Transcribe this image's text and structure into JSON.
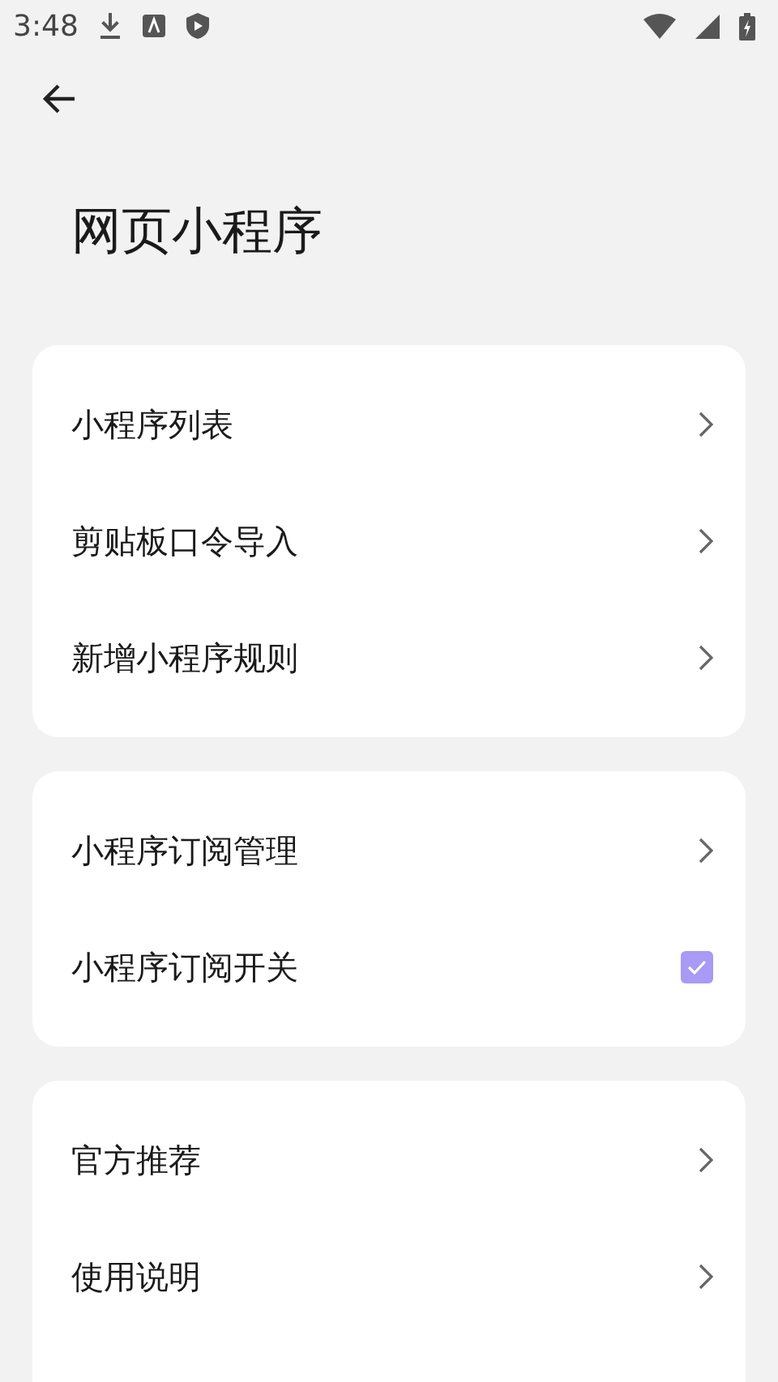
{
  "status_bar": {
    "time": "3:48"
  },
  "title": "网页小程序",
  "groups": [
    {
      "items": [
        {
          "kind": "link",
          "label": "小程序列表"
        },
        {
          "kind": "link",
          "label": "剪贴板口令导入"
        },
        {
          "kind": "link",
          "label": "新增小程序规则"
        }
      ]
    },
    {
      "items": [
        {
          "kind": "link",
          "label": "小程序订阅管理"
        },
        {
          "kind": "checkbox",
          "label": "小程序订阅开关",
          "checked": true
        }
      ]
    },
    {
      "items": [
        {
          "kind": "link",
          "label": "官方推荐"
        },
        {
          "kind": "link",
          "label": "使用说明"
        }
      ]
    }
  ]
}
